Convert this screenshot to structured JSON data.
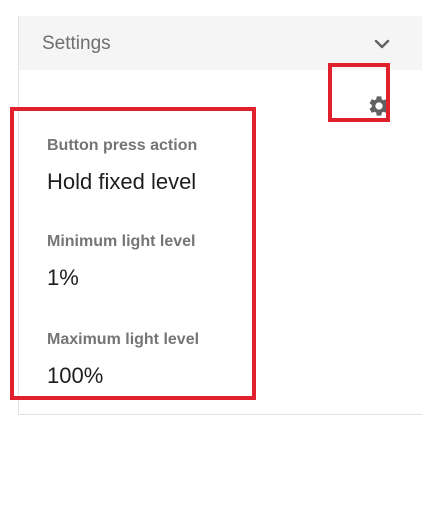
{
  "card": {
    "title": "Settings",
    "expand_icon": "chevron-down-icon",
    "settings_icon": "gear-icon"
  },
  "fields": [
    {
      "label": "Button press action",
      "value": "Hold fixed level"
    },
    {
      "label": "Minimum light level",
      "value": "1%"
    },
    {
      "label": "Maximum light level",
      "value": "100%"
    }
  ],
  "colors": {
    "highlight": "#e0202a",
    "header_bg": "#f5f5f5",
    "icon": "#616161"
  }
}
